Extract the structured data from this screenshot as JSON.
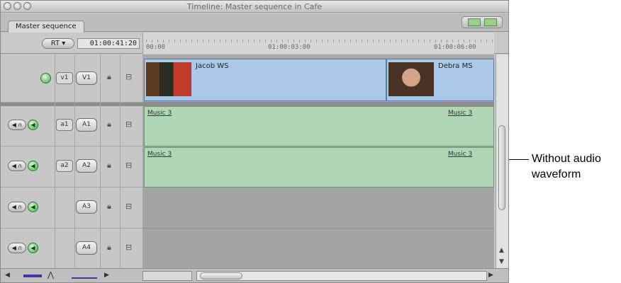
{
  "window": {
    "title": "Timeline: Master sequence in Cafe",
    "tab": "Master sequence",
    "rt_button": "RT",
    "timecode": "01:00:41:20"
  },
  "ruler": {
    "labels": [
      "00:00",
      "01:00:03:00",
      "01:00:06:00"
    ]
  },
  "video_tracks": [
    {
      "source": "v1",
      "dest": "V1"
    }
  ],
  "audio_tracks": [
    {
      "source": "a1",
      "dest": "A1"
    },
    {
      "source": "a2",
      "dest": "A2"
    },
    {
      "source": "",
      "dest": "A3"
    },
    {
      "source": "",
      "dest": "A4"
    }
  ],
  "video_clips": [
    {
      "name": "Jacob WS"
    },
    {
      "name": "Debra MS"
    }
  ],
  "audio_clips": {
    "a1": [
      "Music 3",
      "Music 3"
    ],
    "a2": [
      "Music 3",
      "Music 3"
    ]
  },
  "callout": "Without audio waveform",
  "icons": {
    "lock": "lock-icon",
    "monitor": "monitor-icon",
    "speaker": "speaker-icon"
  }
}
